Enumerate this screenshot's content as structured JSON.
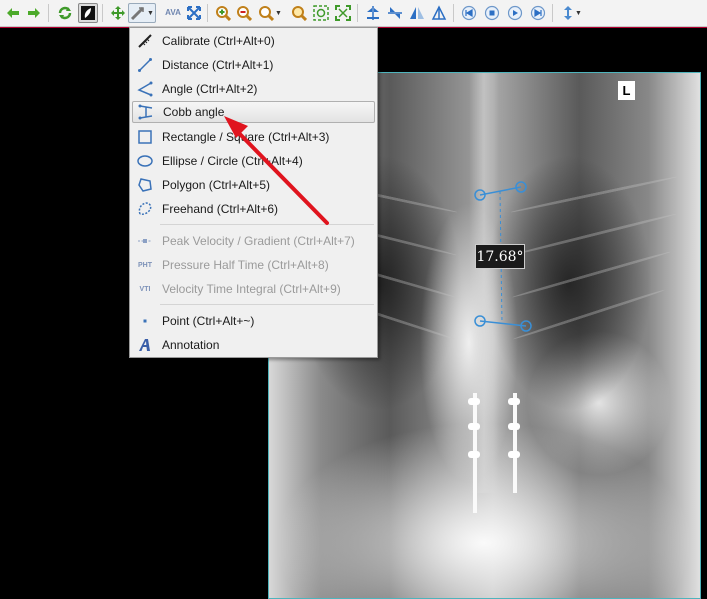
{
  "menu": {
    "items": [
      {
        "label": "Calibrate (Ctrl+Alt+0)",
        "icon": "calibrate-icon",
        "enabled": true
      },
      {
        "label": "Distance (Ctrl+Alt+1)",
        "icon": "distance-icon",
        "enabled": true
      },
      {
        "label": "Angle (Ctrl+Alt+2)",
        "icon": "angle-icon",
        "enabled": true
      },
      {
        "label": "Cobb angle",
        "icon": "cobb-angle-icon",
        "enabled": true,
        "highlighted": true
      },
      {
        "label": "Rectangle / Square (Ctrl+Alt+3)",
        "icon": "rectangle-icon",
        "enabled": true
      },
      {
        "label": "Ellipse / Circle (Ctrl+Alt+4)",
        "icon": "ellipse-icon",
        "enabled": true
      },
      {
        "label": "Polygon (Ctrl+Alt+5)",
        "icon": "polygon-icon",
        "enabled": true
      },
      {
        "label": "Freehand (Ctrl+Alt+6)",
        "icon": "freehand-icon",
        "enabled": true
      },
      {
        "label": "Peak Velocity / Gradient (Ctrl+Alt+7)",
        "icon": "peak-velocity-icon",
        "enabled": false
      },
      {
        "label": "Pressure Half Time (Ctrl+Alt+8)",
        "icon": "pressure-half-time-icon",
        "icon_text": "PHT",
        "enabled": false
      },
      {
        "label": "Velocity Time Integral (Ctrl+Alt+9)",
        "icon": "velocity-time-integral-icon",
        "icon_text": "VTI",
        "enabled": false
      },
      {
        "label": "Point (Ctrl+Alt+~)",
        "icon": "point-icon",
        "enabled": true
      },
      {
        "label": "Annotation",
        "icon": "annotation-icon",
        "enabled": true
      }
    ]
  },
  "toolbar": {
    "ava_label": "AVA",
    "icons": [
      "back-arrow-icon",
      "forward-arrow-icon",
      "refresh-icon",
      "invert-icon",
      "pan-icon",
      "measure-tool-icon",
      "ava-icon",
      "fit-icon",
      "zoom-in-icon",
      "zoom-out-icon",
      "zoom-dropdown-icon",
      "magnifier-icon",
      "zoom-actual-icon",
      "zoom-fit-icon",
      "flip-vertical-icon",
      "flip-horizontal-icon",
      "flip-icon",
      "rotate-icon",
      "first-frame-icon",
      "stop-icon",
      "play-icon",
      "last-frame-icon",
      "scroll-icon"
    ]
  },
  "viewer": {
    "orientation_marker": "L",
    "angle_label": "17.68°"
  },
  "colors": {
    "measure_line": "#3a8fd6",
    "pointer_arrow": "#e0141e",
    "menu_bg": "#f0f0f0",
    "viewer_bg": "#000000"
  }
}
